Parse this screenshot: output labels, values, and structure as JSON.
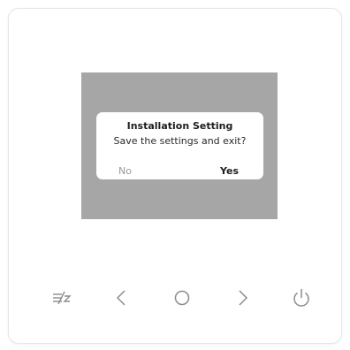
{
  "dialog": {
    "title": "Installation Setting",
    "message": "Save the settings and exit?",
    "no_label": "No",
    "yes_label": "Yes"
  },
  "controls": {
    "buttons": [
      {
        "icon": "menu-toggle-icon"
      },
      {
        "icon": "chevron-left-icon"
      },
      {
        "icon": "circle-ok-icon"
      },
      {
        "icon": "chevron-right-icon"
      },
      {
        "icon": "power-icon"
      }
    ]
  },
  "colors": {
    "screen_background": "#a6a6a6",
    "dialog_background": "#ffffff",
    "button_stroke": "#8c8c8c",
    "no_text": "#9a9a9a",
    "yes_text": "#1e1e1e"
  }
}
